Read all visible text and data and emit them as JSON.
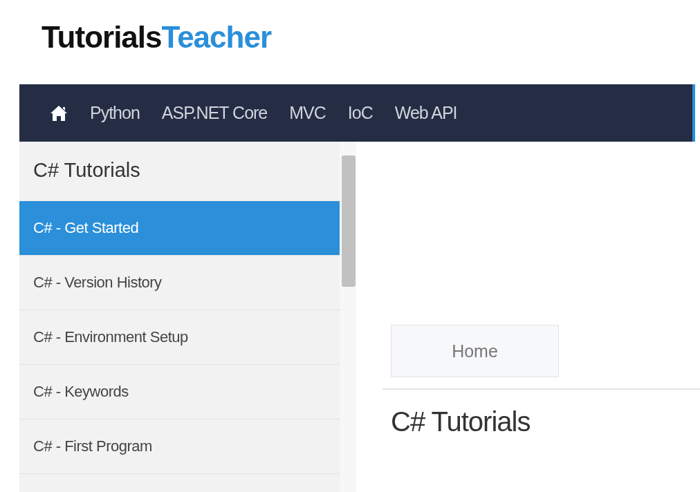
{
  "logo": {
    "part_1": "Tutorials",
    "part_2": "Teacher"
  },
  "nav": {
    "items": [
      {
        "label": "Python"
      },
      {
        "label": "ASP.NET Core"
      },
      {
        "label": "MVC"
      },
      {
        "label": "IoC"
      },
      {
        "label": "Web API"
      }
    ]
  },
  "sidebar": {
    "title": "C# Tutorials",
    "items": [
      {
        "label": "C# - Get Started",
        "selected": true
      },
      {
        "label": "C# - Version History",
        "selected": false
      },
      {
        "label": "C# - Environment Setup",
        "selected": false
      },
      {
        "label": "C# - Keywords",
        "selected": false
      },
      {
        "label": "C# - First Program",
        "selected": false
      }
    ]
  },
  "main": {
    "breadcrumb": "Home",
    "heading": "C# Tutorials"
  }
}
